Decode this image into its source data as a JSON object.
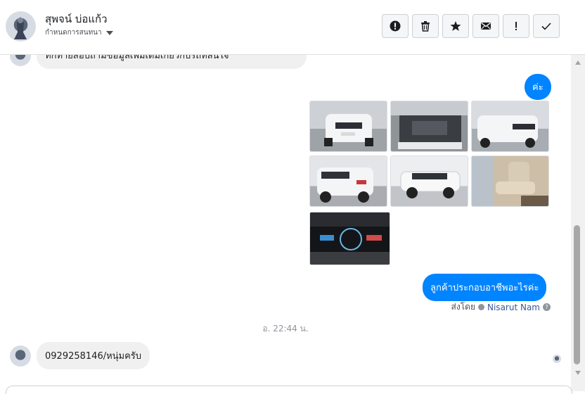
{
  "header": {
    "contact_name": "สุพจน์ บ่อแก้ว",
    "assign_label": "กำหนดการสนทนา",
    "actions": [
      "alert-icon",
      "trash-icon",
      "star-icon",
      "envelope-icon",
      "exclamation-icon",
      "check-icon"
    ]
  },
  "messages": {
    "incoming_top_partial": "ทักทายสอบถามข้อมูลเพิ่มเติมเกี่ยวกับรถที่สนใจ",
    "outgoing_1": "ค่ะ",
    "photos_alt": [
      "ford-front",
      "engine-bay",
      "ford-front-angle",
      "ford-rear",
      "ford-side",
      "interior-seats",
      "dashboard-gauges"
    ],
    "outgoing_2": "ลูกค้าประกอบอาชีพอะไรค่ะ",
    "sent_by_label": "ส่งโดย",
    "sent_by_name": "Nisarut Nam",
    "timestamp": "อ. 22:44 น.",
    "incoming_last": "0929258146/หนุ่มครับ"
  },
  "colors": {
    "brand_blue": "#0084ff",
    "incoming_bg": "#f1f0f0"
  }
}
